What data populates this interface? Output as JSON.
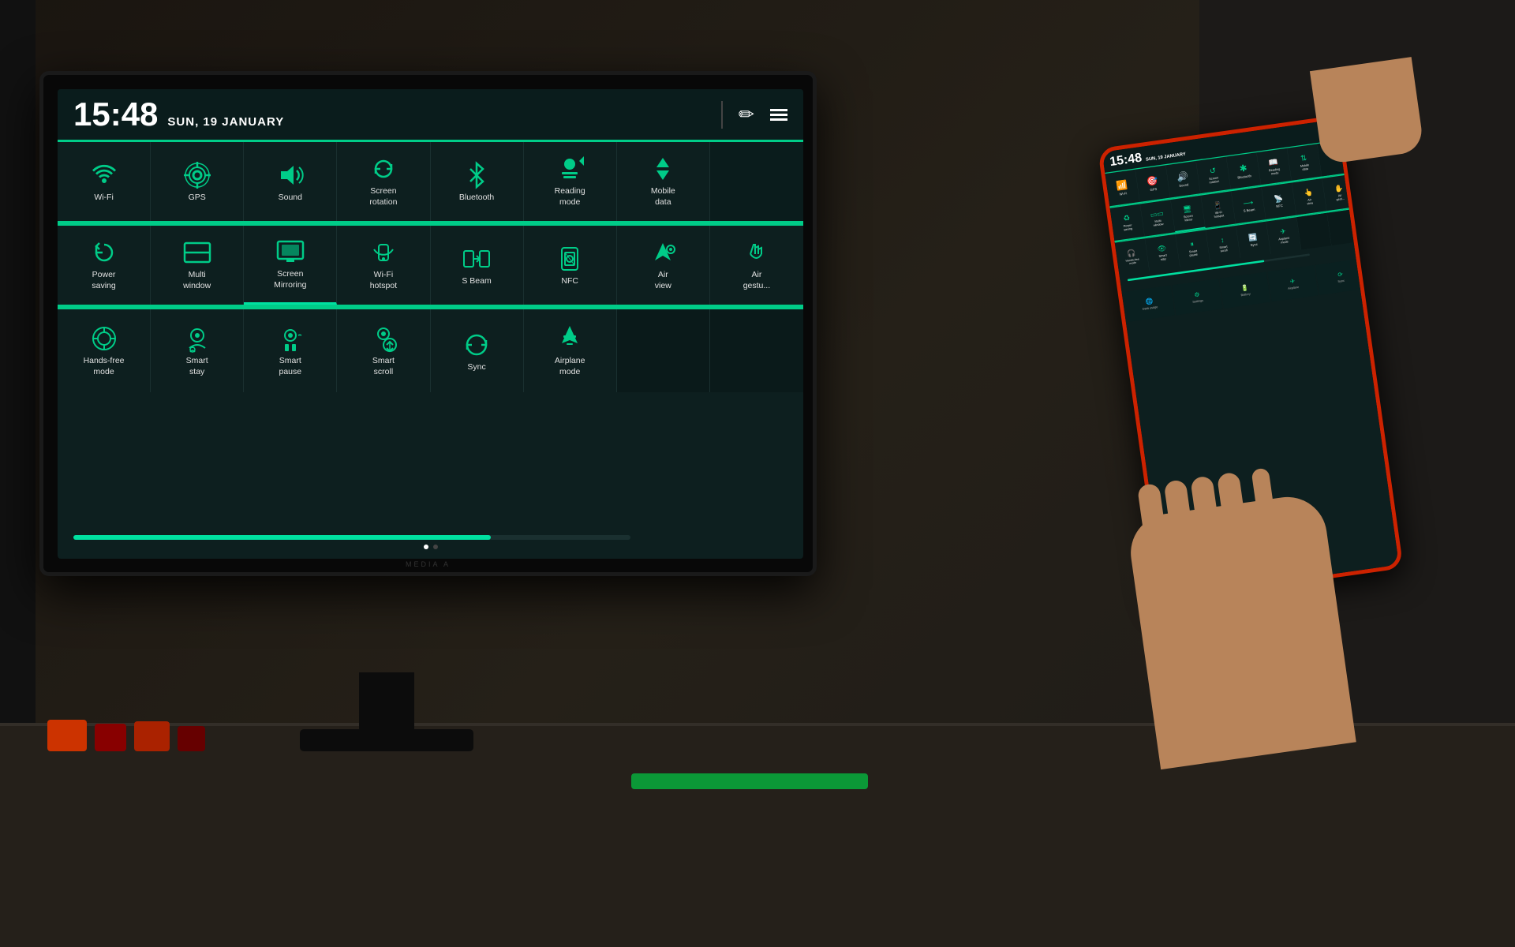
{
  "time": "15:48",
  "date": "SUN, 19 JANUARY",
  "header": {
    "pencil_icon": "✏",
    "menu_icon": "≡"
  },
  "row1": [
    {
      "id": "wifi",
      "label": "Wi-Fi",
      "active": true
    },
    {
      "id": "gps",
      "label": "GPS",
      "active": true
    },
    {
      "id": "sound",
      "label": "Sound",
      "active": true
    },
    {
      "id": "screen-rotation",
      "label": "Screen\nrotation",
      "active": true
    },
    {
      "id": "bluetooth",
      "label": "Bluetooth",
      "active": true
    },
    {
      "id": "reading-mode",
      "label": "Reading\nmode",
      "active": false
    },
    {
      "id": "mobile-data",
      "label": "Mobile\ndata",
      "active": true
    },
    {
      "id": "partial",
      "label": "",
      "active": false
    }
  ],
  "row2": [
    {
      "id": "power-saving",
      "label": "Power\nsaving",
      "active": false
    },
    {
      "id": "multi-window",
      "label": "Multi\nwindow",
      "active": false
    },
    {
      "id": "screen-mirroring",
      "label": "Screen\nMirroring",
      "active": true
    },
    {
      "id": "wifi-hotspot",
      "label": "Wi-Fi\nhotspot",
      "active": false
    },
    {
      "id": "s-beam",
      "label": "S Beam",
      "active": false
    },
    {
      "id": "nfc",
      "label": "NFC",
      "active": false
    },
    {
      "id": "air-view",
      "label": "Air\nview",
      "active": false
    },
    {
      "id": "air-gesture",
      "label": "Air\ngestu...",
      "active": false
    }
  ],
  "row3": [
    {
      "id": "hands-free",
      "label": "Hands-free\nmode",
      "active": false
    },
    {
      "id": "smart-stay",
      "label": "Smart\nstay",
      "active": false
    },
    {
      "id": "smart-pause",
      "label": "Smart\npause",
      "active": false
    },
    {
      "id": "smart-scroll",
      "label": "Smart\nscroll",
      "active": false
    },
    {
      "id": "sync",
      "label": "Sync",
      "active": false
    },
    {
      "id": "airplane-mode",
      "label": "Airplane\nmode",
      "active": false
    }
  ],
  "progress": {
    "value": 75,
    "dot_active": 0
  },
  "colors": {
    "accent": "#00cc88",
    "bg": "#0d2020",
    "text": "#e0e0e0",
    "active_border": "#00e0a0"
  }
}
